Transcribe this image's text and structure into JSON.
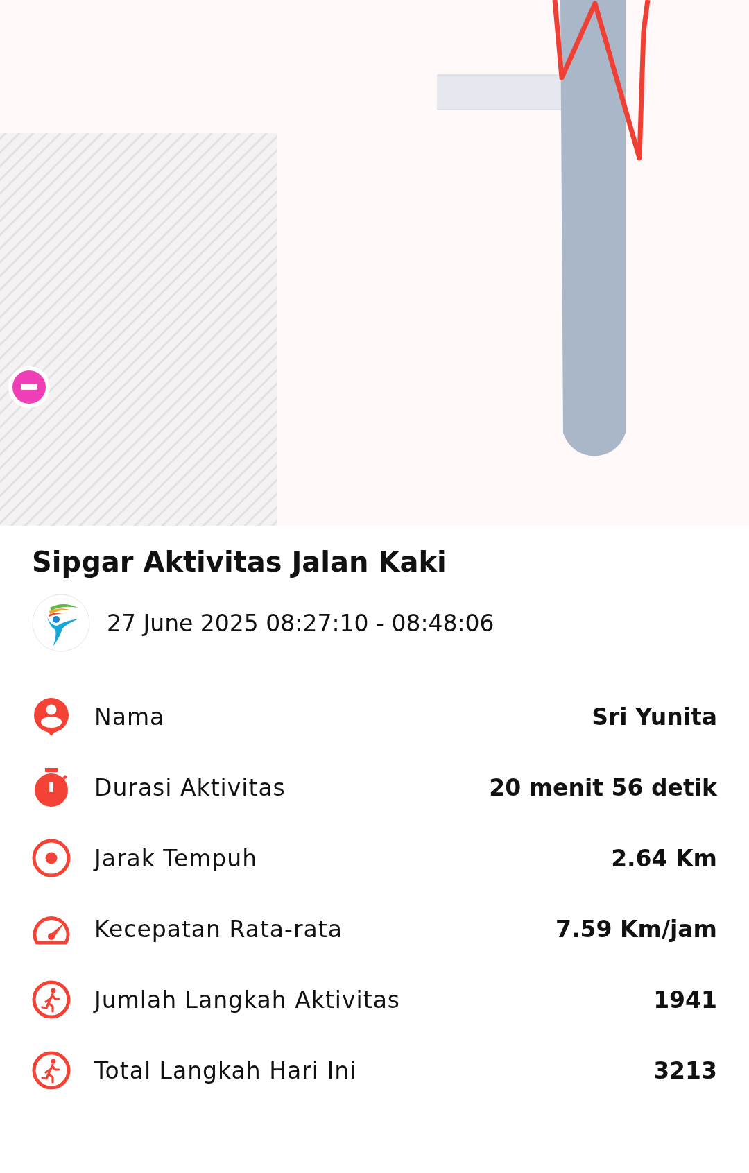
{
  "title": "Sipgar Aktivitas Jalan Kaki",
  "date": "27 June 2025 08:27:10 - 08:48:06",
  "stats": [
    {
      "kind": "person",
      "label": "Nama",
      "value": "Sri Yunita"
    },
    {
      "kind": "timer",
      "label": "Durasi Aktivitas",
      "value": "20 menit 56 detik"
    },
    {
      "kind": "target",
      "label": "Jarak Tempuh",
      "value": "2.64 Km"
    },
    {
      "kind": "speed",
      "label": "Kecepatan Rata-rata",
      "value": "7.59 Km/jam"
    },
    {
      "kind": "steps",
      "label": "Jumlah Langkah Aktivitas",
      "value": "1941"
    },
    {
      "kind": "steps",
      "label": "Total Langkah Hari Ini",
      "value": "3213"
    }
  ]
}
